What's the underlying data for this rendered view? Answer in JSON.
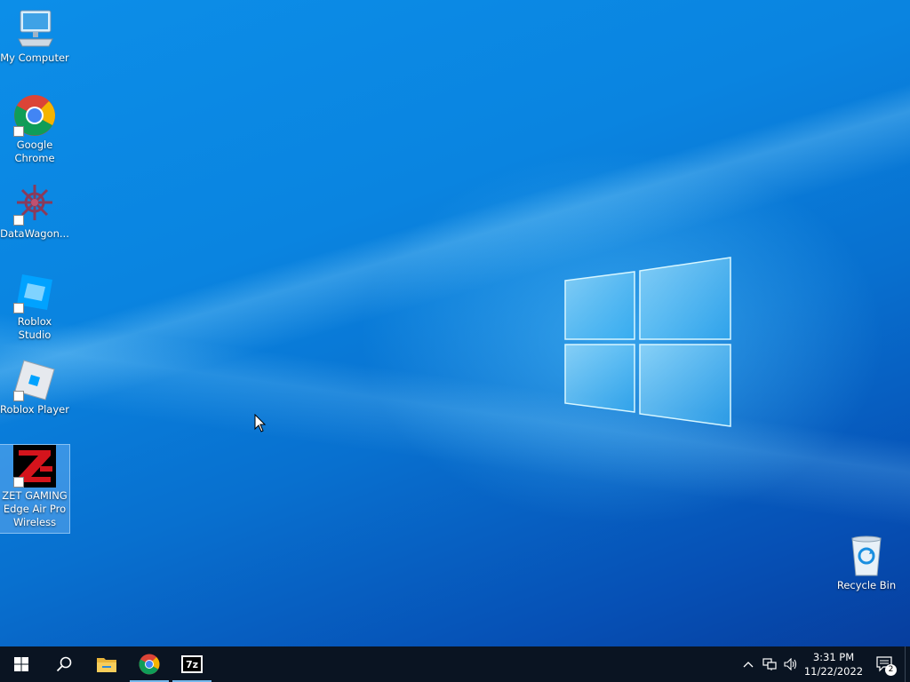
{
  "desktop": {
    "icons": [
      {
        "label": "My Computer"
      },
      {
        "label": "Google Chrome"
      },
      {
        "label": "DataWagon..."
      },
      {
        "label": "Roblox Studio"
      },
      {
        "label": "Roblox Player"
      },
      {
        "label": "ZET GAMING Edge Air Pro Wireless"
      },
      {
        "label": "Recycle Bin"
      }
    ]
  },
  "taskbar": {
    "apps": [
      "start-icon",
      "search-icon",
      "file-explorer-icon",
      "chrome-icon",
      "7zip-icon"
    ],
    "sevenzip_label": "7z",
    "clock": {
      "time": "3:31 PM",
      "date": "11/22/2022"
    },
    "notification_count": "2"
  },
  "colors": {
    "accent": "#0a78d6",
    "taskbar": "#0a1422"
  }
}
